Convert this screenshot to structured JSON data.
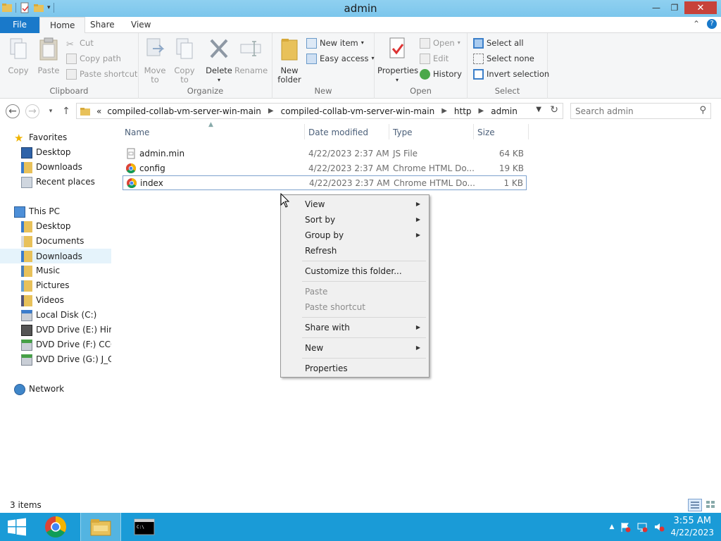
{
  "window": {
    "title": "admin"
  },
  "tabs": {
    "file": "File",
    "home": "Home",
    "share": "Share",
    "view": "View"
  },
  "ribbon": {
    "clipboard": {
      "label": "Clipboard",
      "copy": "Copy",
      "paste": "Paste",
      "cut": "Cut",
      "copy_path": "Copy path",
      "paste_shortcut": "Paste shortcut"
    },
    "organize": {
      "label": "Organize",
      "move_to_1": "Move",
      "move_to_2": "to",
      "copy_to_1": "Copy",
      "copy_to_2": "to",
      "delete": "Delete",
      "rename": "Rename"
    },
    "new": {
      "label": "New",
      "new_folder_1": "New",
      "new_folder_2": "folder",
      "new_item": "New item",
      "easy_access": "Easy access"
    },
    "open": {
      "label": "Open",
      "properties": "Properties",
      "open": "Open",
      "edit": "Edit",
      "history": "History"
    },
    "select": {
      "label": "Select",
      "select_all": "Select all",
      "select_none": "Select none",
      "invert_selection": "Invert selection"
    }
  },
  "address": {
    "overflow": "«",
    "crumbs": [
      "compiled-collab-vm-server-win-main",
      "compiled-collab-vm-server-win-main",
      "http",
      "admin"
    ]
  },
  "search": {
    "placeholder": "Search admin"
  },
  "navpane": {
    "favorites": "Favorites",
    "fav_items": [
      "Desktop",
      "Downloads",
      "Recent places"
    ],
    "this_pc": "This PC",
    "pc_items": [
      "Desktop",
      "Documents",
      "Downloads",
      "Music",
      "Pictures",
      "Videos",
      "Local Disk (C:)",
      "DVD Drive (E:) Hiren",
      "DVD Drive (F:) CCCC",
      "DVD Drive (G:) J_CEN"
    ],
    "network": "Network"
  },
  "columns": {
    "name": "Name",
    "date": "Date modified",
    "type": "Type",
    "size": "Size"
  },
  "files": [
    {
      "name": "admin.min",
      "date": "4/22/2023 2:37 AM",
      "type": "JS File",
      "size": "64 KB",
      "icon": "js-file-icon"
    },
    {
      "name": "config",
      "date": "4/22/2023 2:37 AM",
      "type": "Chrome HTML Do...",
      "size": "19 KB",
      "icon": "chrome-html-icon"
    },
    {
      "name": "index",
      "date": "4/22/2023 2:37 AM",
      "type": "Chrome HTML Do...",
      "size": "1 KB",
      "icon": "chrome-html-icon"
    }
  ],
  "context_menu": {
    "view": "View",
    "sort_by": "Sort by",
    "group_by": "Group by",
    "refresh": "Refresh",
    "customize": "Customize this folder...",
    "paste": "Paste",
    "paste_shortcut": "Paste shortcut",
    "share_with": "Share with",
    "new": "New",
    "properties": "Properties"
  },
  "status": {
    "item_count": "3 items"
  },
  "taskbar": {
    "time": "3:55 AM",
    "date": "4/22/2023"
  },
  "colors": {
    "accent": "#1979ca",
    "taskbar": "#1a9bd7",
    "titlebar": "#8fd0f0",
    "close": "#c7423a"
  }
}
